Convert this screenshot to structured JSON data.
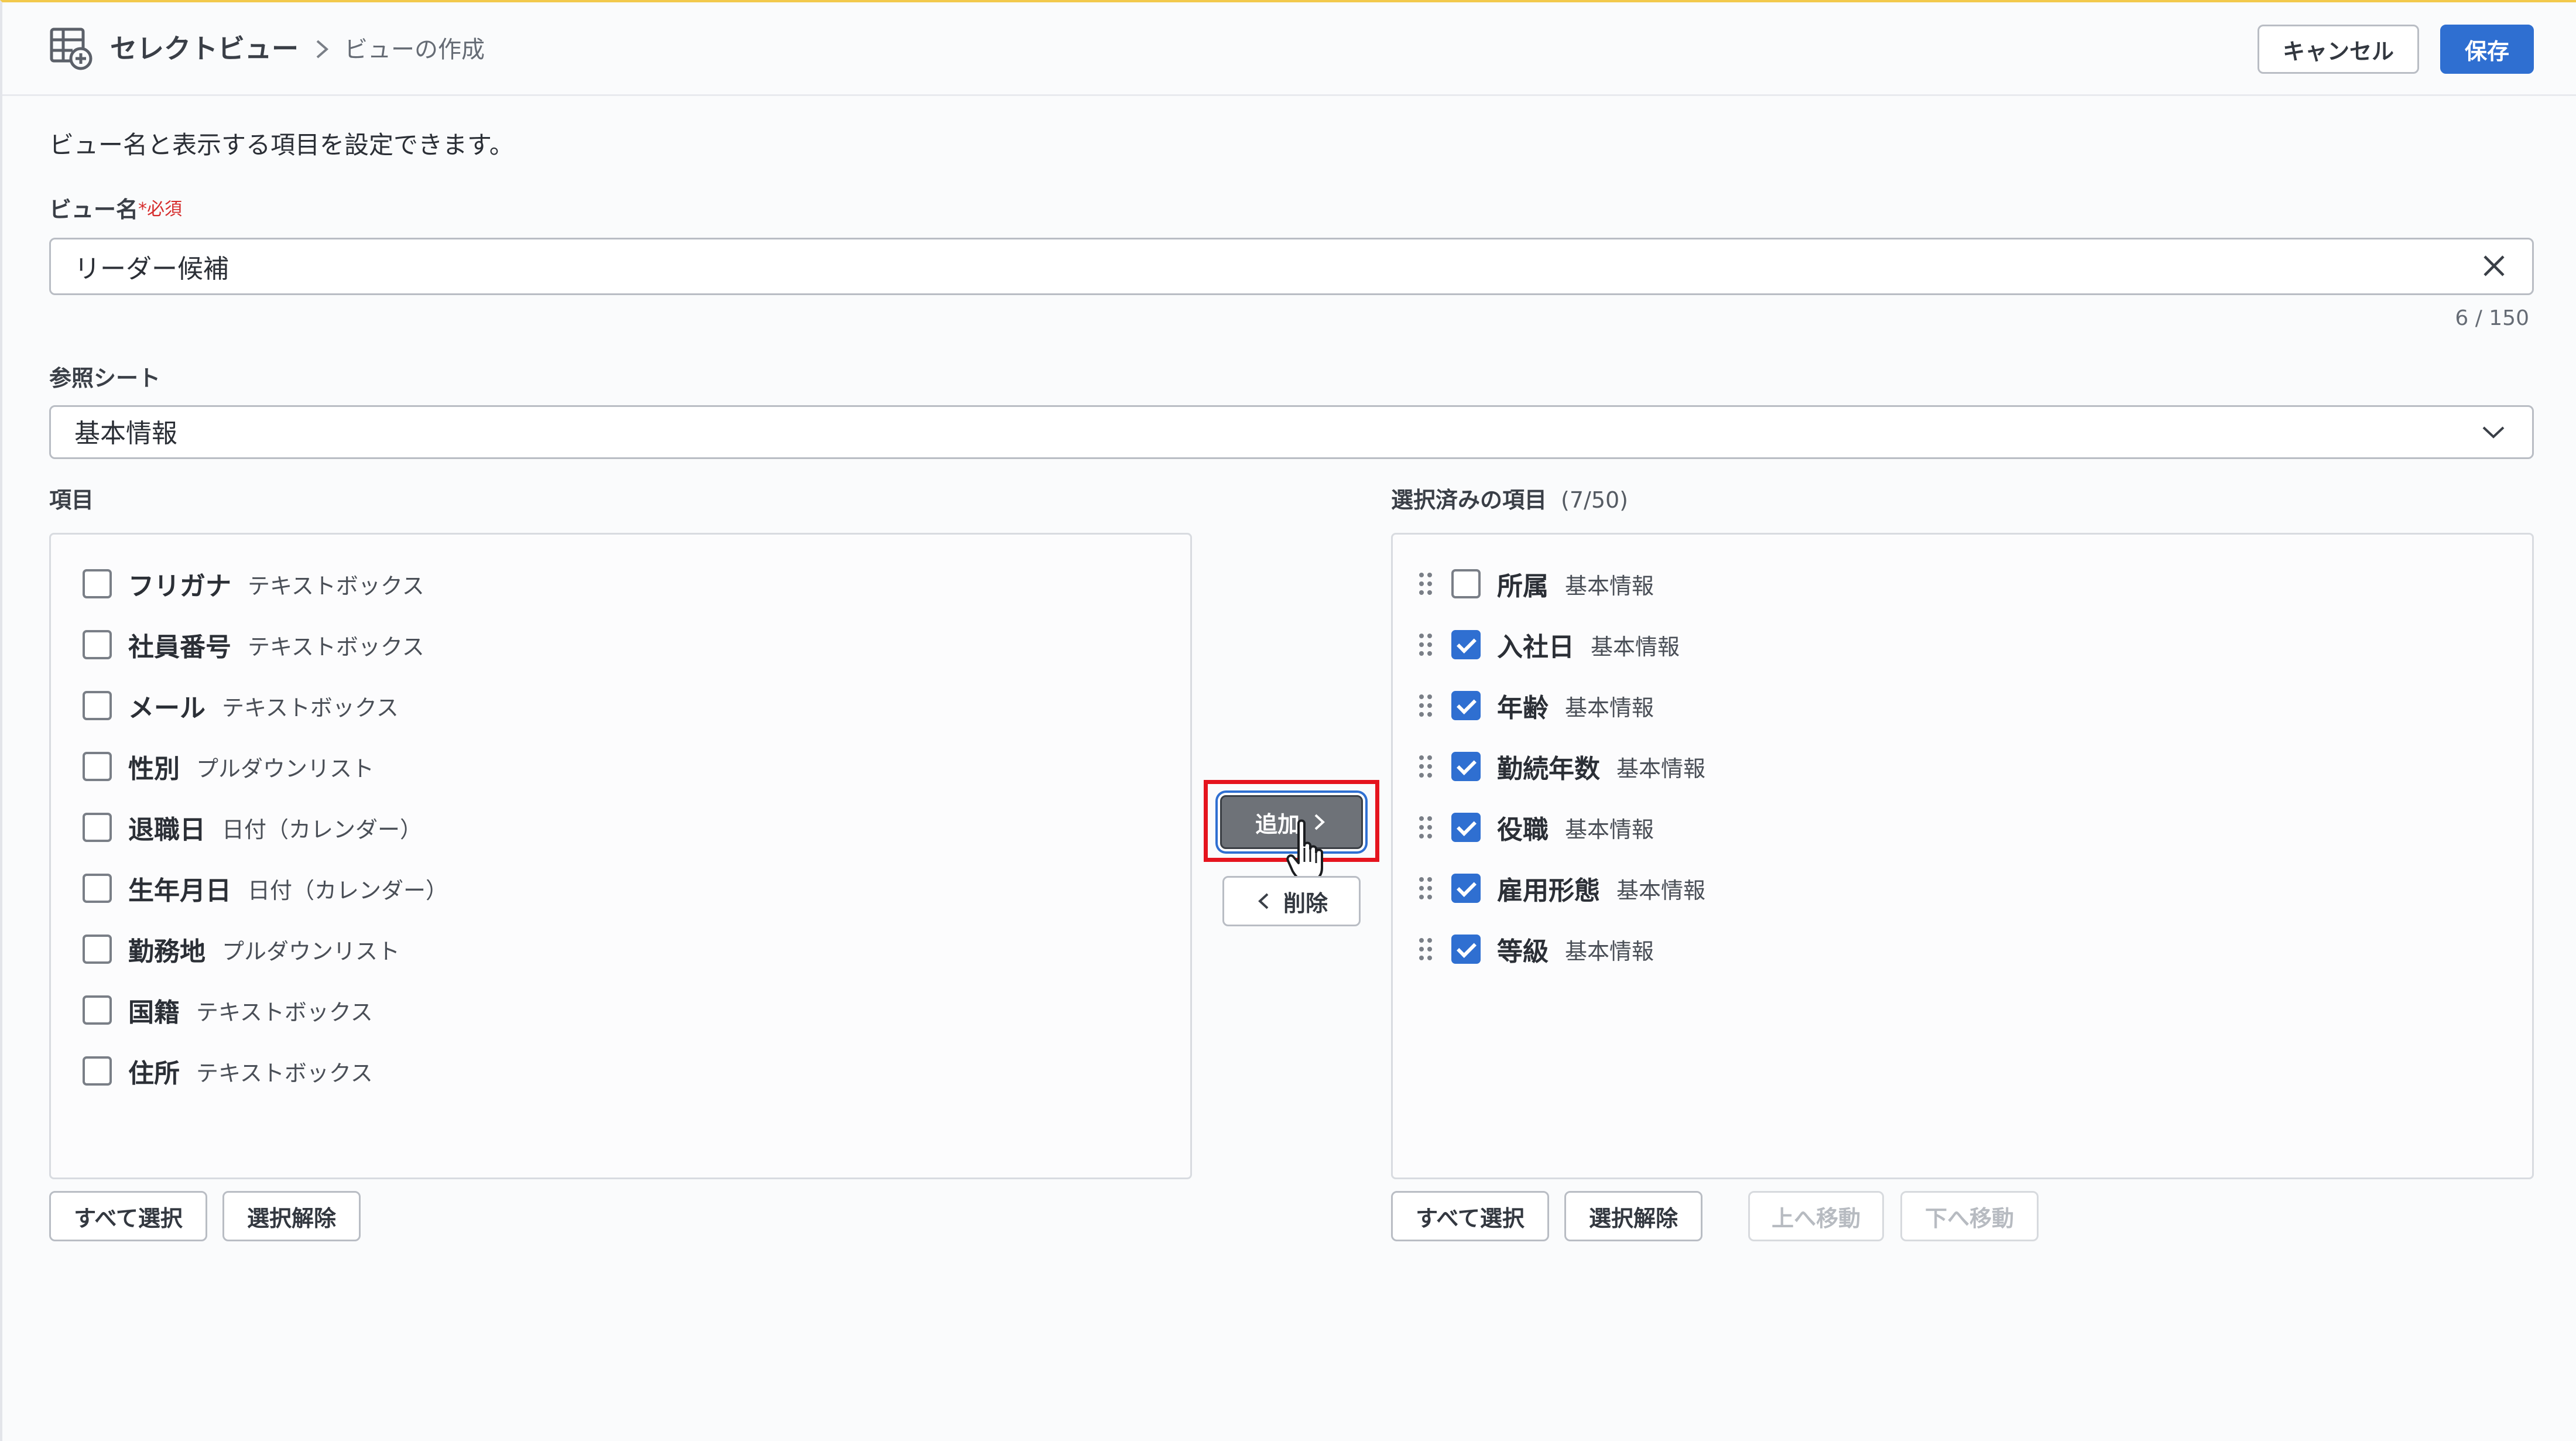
{
  "header": {
    "app_title": "セレクトビュー",
    "breadcrumb_current": "ビューの作成",
    "cancel_label": "キャンセル",
    "save_label": "保存"
  },
  "description": "ビュー名と表示する項目を設定できます。",
  "view_name": {
    "label": "ビュー名",
    "required_mark": "*必須",
    "value": "リーダー候補",
    "char_count": "6 / 150"
  },
  "reference_sheet": {
    "label": "参照シート",
    "value": "基本情報"
  },
  "available_items": {
    "label": "項目",
    "items": [
      {
        "name": "フリガナ",
        "type": "テキストボックス",
        "checked": false
      },
      {
        "name": "社員番号",
        "type": "テキストボックス",
        "checked": false
      },
      {
        "name": "メール",
        "type": "テキストボックス",
        "checked": false
      },
      {
        "name": "性別",
        "type": "プルダウンリスト",
        "checked": false
      },
      {
        "name": "退職日",
        "type": "日付（カレンダー）",
        "checked": false
      },
      {
        "name": "生年月日",
        "type": "日付（カレンダー）",
        "checked": false
      },
      {
        "name": "勤務地",
        "type": "プルダウンリスト",
        "checked": false
      },
      {
        "name": "国籍",
        "type": "テキストボックス",
        "checked": false
      },
      {
        "name": "住所",
        "type": "テキストボックス",
        "checked": false
      }
    ],
    "select_all_label": "すべて選択",
    "deselect_label": "選択解除"
  },
  "transfer": {
    "add_label": "追加",
    "remove_label": "削除"
  },
  "selected_items": {
    "label": "選択済みの項目",
    "count": "(7/50)",
    "items": [
      {
        "name": "所属",
        "type": "基本情報",
        "checked": false
      },
      {
        "name": "入社日",
        "type": "基本情報",
        "checked": true
      },
      {
        "name": "年齢",
        "type": "基本情報",
        "checked": true
      },
      {
        "name": "勤続年数",
        "type": "基本情報",
        "checked": true
      },
      {
        "name": "役職",
        "type": "基本情報",
        "checked": true
      },
      {
        "name": "雇用形態",
        "type": "基本情報",
        "checked": true
      },
      {
        "name": "等級",
        "type": "基本情報",
        "checked": true
      }
    ],
    "select_all_label": "すべて選択",
    "deselect_label": "選択解除",
    "move_up_label": "上へ移動",
    "move_down_label": "下へ移動"
  },
  "colors": {
    "accent": "#2f6fd1",
    "highlight": "#e5141e",
    "required": "#d62c2c"
  },
  "icons": {
    "app": "table-add-icon",
    "breadcrumb": "chevron-right-icon",
    "clear": "close-icon",
    "select": "chevron-down-icon",
    "drag": "drag-handle-icon",
    "cursor": "hand-pointer-icon"
  }
}
